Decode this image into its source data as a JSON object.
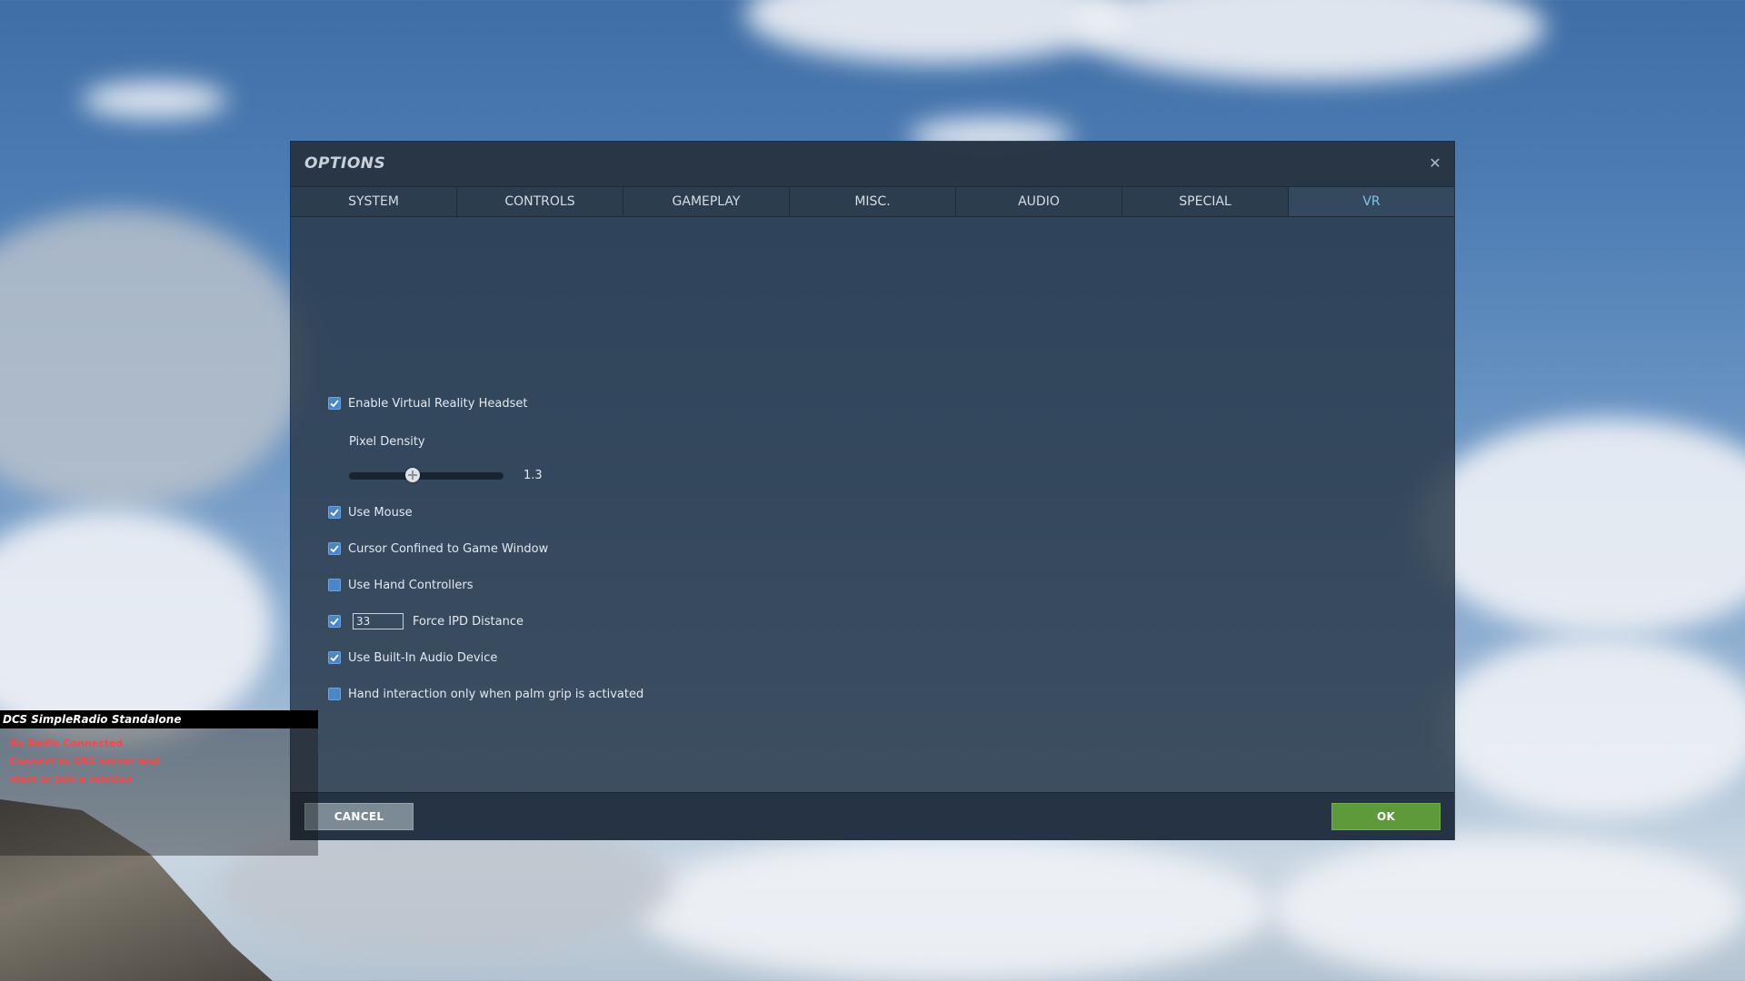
{
  "dialog": {
    "title": "OPTIONS",
    "close_icon": "close-icon"
  },
  "tabs": [
    {
      "label": "SYSTEM",
      "active": false
    },
    {
      "label": "CONTROLS",
      "active": false
    },
    {
      "label": "GAMEPLAY",
      "active": false
    },
    {
      "label": "MISC.",
      "active": false
    },
    {
      "label": "AUDIO",
      "active": false
    },
    {
      "label": "SPECIAL",
      "active": false
    },
    {
      "label": "VR",
      "active": true
    }
  ],
  "vr": {
    "enable_headset": {
      "label": "Enable Virtual Reality Headset",
      "checked": true
    },
    "pixel_density": {
      "label": "Pixel Density",
      "value": "1.3",
      "fraction": 0.4
    },
    "use_mouse": {
      "label": "Use Mouse",
      "checked": true
    },
    "cursor_confined": {
      "label": "Cursor Confined to Game Window",
      "checked": true
    },
    "hand_controllers": {
      "label": "Use Hand Controllers",
      "checked": false
    },
    "force_ipd": {
      "label": "Force IPD Distance",
      "checked": true,
      "value": "33"
    },
    "builtin_audio": {
      "label": "Use Built-In Audio Device",
      "checked": true
    },
    "palm_grip": {
      "label": "Hand interaction only when palm grip is activated",
      "checked": false
    }
  },
  "footer": {
    "cancel_label": "CANCEL",
    "ok_label": "OK"
  },
  "srs": {
    "title": "DCS SimpleRadio Standalone",
    "line1": "No Radio Connected",
    "line2": "Connect to SRS server and",
    "line3": "start or join a mission"
  },
  "colors": {
    "active_tab_text": "#7fc6e8",
    "checkbox": "#4b86c8",
    "ok_button": "#5c9a3a",
    "cancel_button": "#7b8a94",
    "srs_warning": "#ff4444"
  }
}
